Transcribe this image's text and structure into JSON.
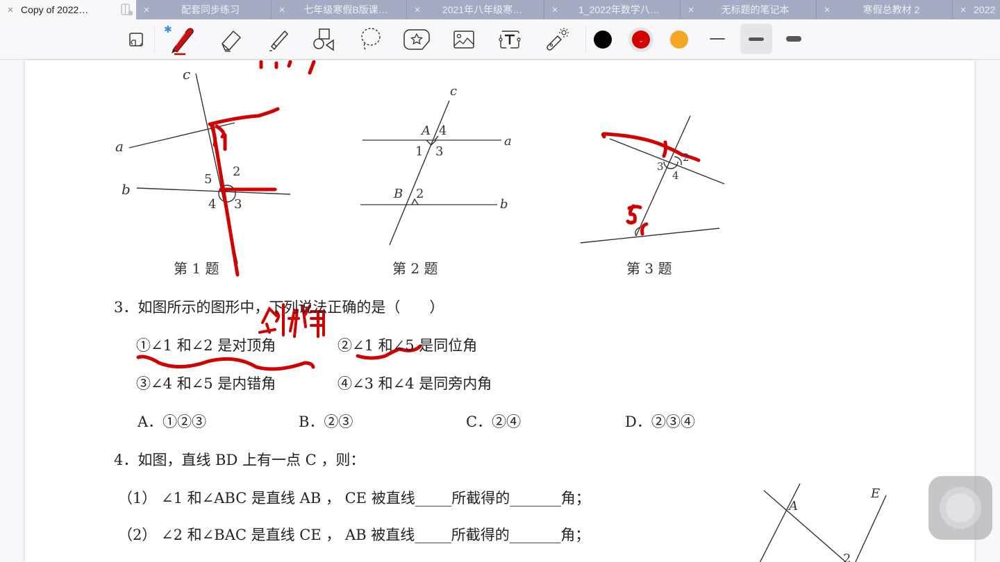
{
  "tabs": [
    {
      "label": "Copy of 2022…",
      "active": true
    },
    {
      "label": "配套同步练习"
    },
    {
      "label": "七年级寒假B版课…"
    },
    {
      "label": "2021年八年级寒…"
    },
    {
      "label": "1_2022年数学八…"
    },
    {
      "label": "无标题的笔记本"
    },
    {
      "label": "寒假总教材 2"
    },
    {
      "label": "2022"
    }
  ],
  "toolbar": {
    "tools": [
      "page-view",
      "pen",
      "eraser",
      "highlighter",
      "shapes",
      "lasso",
      "sticker",
      "image",
      "text",
      "laser-pointer"
    ],
    "active_tool": "pen",
    "bluetooth": "✱",
    "colors": [
      {
        "name": "black",
        "hex": "#000000"
      },
      {
        "name": "red",
        "hex": "#d40000",
        "selected": true
      },
      {
        "name": "orange",
        "hex": "#f5a623"
      }
    ],
    "thickness": [
      "thin",
      "medium",
      "thick"
    ],
    "selected_thickness": "medium"
  },
  "document": {
    "fig1": {
      "labels": {
        "c": "c",
        "a": "a",
        "b": "b",
        "n5": "5",
        "n2": "2",
        "n4": "4",
        "n3": "3"
      },
      "caption": "第 1 题"
    },
    "fig2": {
      "labels": {
        "c": "c",
        "A": "A",
        "n4": "4",
        "a": "a",
        "n1": "1",
        "n3": "3",
        "B": "B",
        "n2": "2",
        "b": "b"
      },
      "caption": "第 2 题"
    },
    "fig3": {
      "labels": {
        "n3": "3",
        "n2": "2",
        "n4": "4"
      },
      "caption": "第 3 题"
    },
    "q3": {
      "stem": "3．如图所示的图形中，下列说法正确的是（　　）",
      "statements": [
        "①∠1 和∠2 是对顶角",
        "②∠1 和∠5 是同位角",
        "③∠4 和∠5 是内错角",
        "④∠3 和∠4 是同旁内角"
      ],
      "options": [
        {
          "letter": "A．",
          "value": "①②③"
        },
        {
          "letter": "B．",
          "value": "②③"
        },
        {
          "letter": "C．",
          "value": "②④"
        },
        {
          "letter": "D．",
          "value": "②③④"
        }
      ]
    },
    "q4": {
      "stem": "4．如图，直线 BD 上有一点 C ，则：",
      "parts": [
        "（1） ∠1 和∠ABC 是直线 AB ， CE 被直线_____所截得的_______角；",
        "（2） ∠2 和∠BAC 是直线 CE ， AB 被直线_____所截得的_______角；"
      ],
      "fig_labels": {
        "A": "A",
        "E": "E",
        "n2": "2"
      }
    },
    "handwriting": {
      "color": "#d40000",
      "annotation_q3": "邻补角",
      "fig3_mark": "5"
    }
  }
}
